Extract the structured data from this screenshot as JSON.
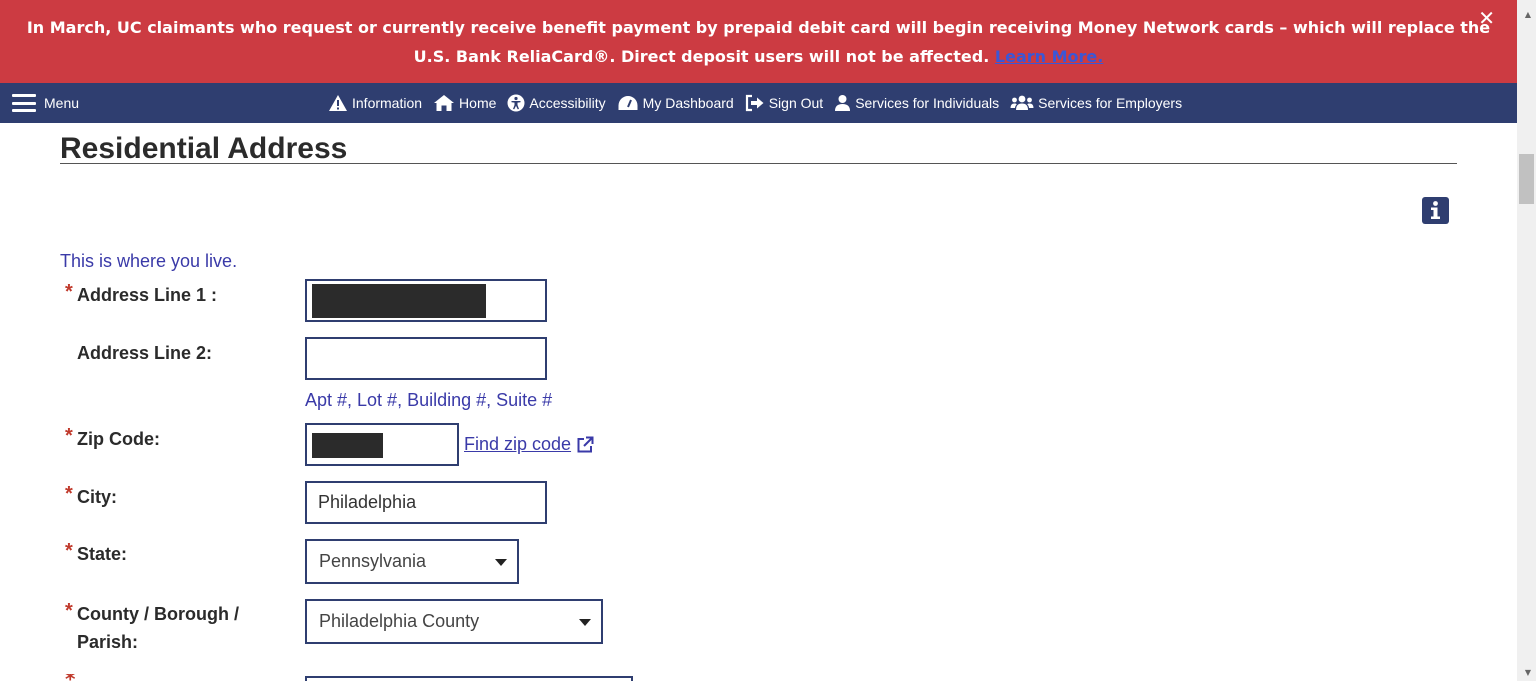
{
  "alert": {
    "line1": "In March, UC claimants who request or currently receive benefit payment by prepaid debit card will begin receiving Money Network cards – which will replace the",
    "line2": "U.S. Bank ReliaCard®. Direct deposit users will not be affected.",
    "learn_more": "Learn More.",
    "close": "✕",
    "bg_color": "#cc3b42"
  },
  "nav": {
    "menu_label": "Menu",
    "links": [
      {
        "label": "Information",
        "icon": "warning-icon"
      },
      {
        "label": "Home",
        "icon": "home-icon"
      },
      {
        "label": "Accessibility",
        "icon": "accessibility-icon"
      },
      {
        "label": "My Dashboard",
        "icon": "dashboard-icon"
      },
      {
        "label": "Sign Out",
        "icon": "sign-out-icon"
      },
      {
        "label": "Services for Individuals",
        "icon": "user-icon"
      },
      {
        "label": "Services for Employers",
        "icon": "users-icon"
      }
    ],
    "bg_color": "#2f3e70"
  },
  "page": {
    "title": "Residential Address",
    "intro": "This is where you live."
  },
  "form": {
    "address1": {
      "label": "Address Line 1 :",
      "value": ""
    },
    "address2": {
      "label": "Address Line 2:",
      "value": "",
      "hint": "Apt #, Lot #, Building #, Suite #"
    },
    "zip": {
      "label": "Zip Code:",
      "value": "",
      "find_link": "Find zip code"
    },
    "city": {
      "label": "City:",
      "value": "Philadelphia"
    },
    "state": {
      "label": "State:",
      "value": "Pennsylvania"
    },
    "county": {
      "label_line1": "County / Borough /",
      "label_line2": "Parish:",
      "value": "Philadelphia County"
    },
    "required_mark": "*"
  }
}
